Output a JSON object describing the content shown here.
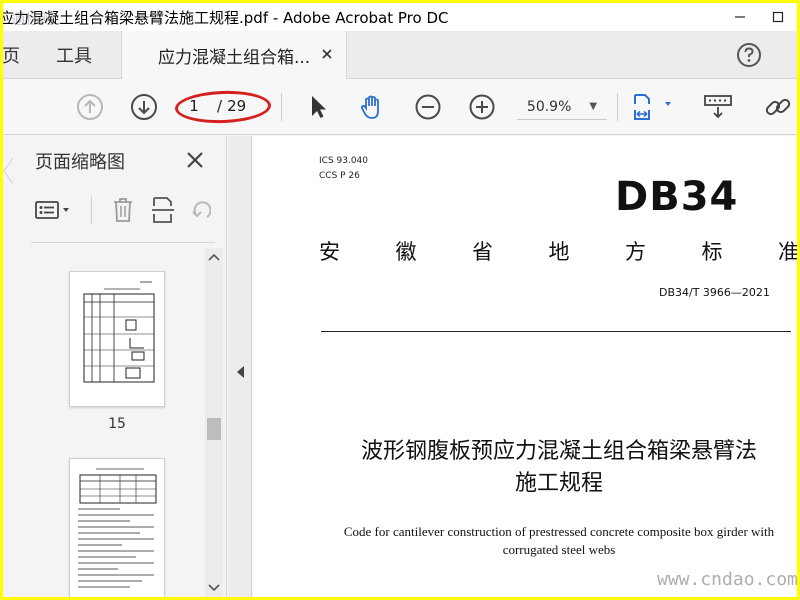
{
  "window": {
    "title": "应力混凝土组合箱梁悬臂法施工规程.pdf - Adobe Acrobat Pro DC",
    "watermark_top": "通标网",
    "watermark_bottom": "www.cndao.com"
  },
  "tabs": {
    "home": "页",
    "tools": "工具",
    "document": "应力混凝土组合箱..."
  },
  "toolbar": {
    "current_page": "1",
    "total_pages": "29",
    "zoom": "50.9%",
    "highlight_color": "#d4201f"
  },
  "sidebar": {
    "title": "页面缩略图",
    "thumbnails": [
      {
        "label": "15"
      },
      {
        "label": ""
      }
    ]
  },
  "document": {
    "ics": "ICS  93.040",
    "ccs": "CCS  P 26",
    "logo": "DB34",
    "std_title_chars": [
      "安",
      "徽",
      "省",
      "地",
      "方",
      "标",
      "准"
    ],
    "std_code": "DB34/T 3966—2021",
    "title_line1": "波形钢腹板预应力混凝土组合箱梁悬臂法",
    "title_line2": "施工规程",
    "english_line1": "Code for cantilever construction of prestressed concrete composite box girder with",
    "english_line2": "corrugated steel webs"
  },
  "colors": {
    "accent": "#2d6fd0",
    "frame": "#ffff00"
  }
}
